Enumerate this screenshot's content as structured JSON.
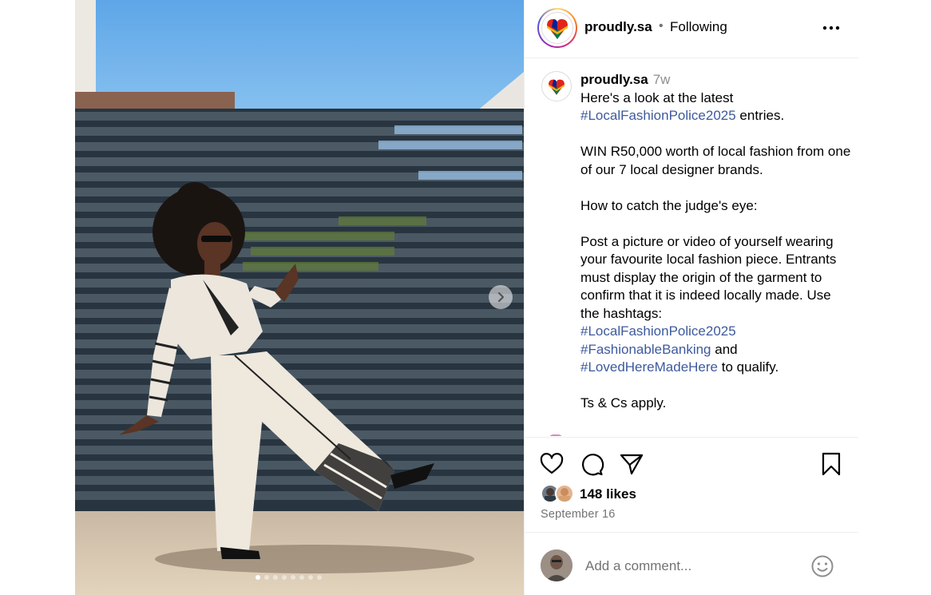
{
  "post": {
    "username": "proudly.sa",
    "separator": "•",
    "follow_status": "Following",
    "more_icon": "more-horizontal-icon"
  },
  "caption": {
    "username": "proudly.sa",
    "time_ago": "7w",
    "line1": "Here's a look at the latest",
    "tag1": "#LocalFashionPolice2025",
    "line2": " entries.",
    "para2": "WIN R50,000 worth of local fashion from one of our 7 local designer brands.",
    "para3": "How to catch the judge's eye:",
    "para4": "Post a picture or video of yourself wearing your favourite local fashion piece. Entrants must display the origin of the garment to confirm that it is indeed locally made. Use the hashtags:",
    "tag2": "#LocalFashionPolice2025",
    "tag3": "#FashionableBanking",
    "and_text": " and",
    "tag4": "#LovedHereMadeHere",
    "qualify_text": " to qualify.",
    "para5": "Ts & Cs apply."
  },
  "carousel": {
    "slide_count": 8,
    "active_index": 0,
    "next_icon": "chevron-right-icon"
  },
  "engagement": {
    "likes": "148 likes",
    "date": "September 16",
    "icons": [
      "heart-icon",
      "comment-icon",
      "share-icon",
      "bookmark-icon"
    ]
  },
  "comment_box": {
    "placeholder": "Add a comment...",
    "emoji_icon": "emoji-icon"
  },
  "colors": {
    "hashtag": "#3d5a9e",
    "muted": "#737373",
    "sky": "#6aaee8",
    "fence": "#3a4650"
  }
}
